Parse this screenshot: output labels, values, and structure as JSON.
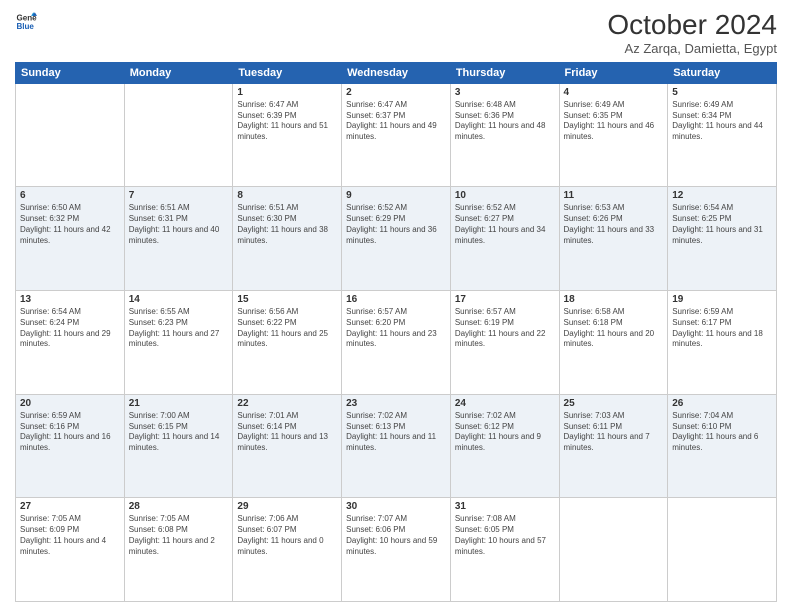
{
  "header": {
    "logo_line1": "General",
    "logo_line2": "Blue",
    "month": "October 2024",
    "location": "Az Zarqa, Damietta, Egypt"
  },
  "weekdays": [
    "Sunday",
    "Monday",
    "Tuesday",
    "Wednesday",
    "Thursday",
    "Friday",
    "Saturday"
  ],
  "weeks": [
    [
      {
        "day": "",
        "content": ""
      },
      {
        "day": "",
        "content": ""
      },
      {
        "day": "1",
        "content": "Sunrise: 6:47 AM\nSunset: 6:39 PM\nDaylight: 11 hours and 51 minutes."
      },
      {
        "day": "2",
        "content": "Sunrise: 6:47 AM\nSunset: 6:37 PM\nDaylight: 11 hours and 49 minutes."
      },
      {
        "day": "3",
        "content": "Sunrise: 6:48 AM\nSunset: 6:36 PM\nDaylight: 11 hours and 48 minutes."
      },
      {
        "day": "4",
        "content": "Sunrise: 6:49 AM\nSunset: 6:35 PM\nDaylight: 11 hours and 46 minutes."
      },
      {
        "day": "5",
        "content": "Sunrise: 6:49 AM\nSunset: 6:34 PM\nDaylight: 11 hours and 44 minutes."
      }
    ],
    [
      {
        "day": "6",
        "content": "Sunrise: 6:50 AM\nSunset: 6:32 PM\nDaylight: 11 hours and 42 minutes."
      },
      {
        "day": "7",
        "content": "Sunrise: 6:51 AM\nSunset: 6:31 PM\nDaylight: 11 hours and 40 minutes."
      },
      {
        "day": "8",
        "content": "Sunrise: 6:51 AM\nSunset: 6:30 PM\nDaylight: 11 hours and 38 minutes."
      },
      {
        "day": "9",
        "content": "Sunrise: 6:52 AM\nSunset: 6:29 PM\nDaylight: 11 hours and 36 minutes."
      },
      {
        "day": "10",
        "content": "Sunrise: 6:52 AM\nSunset: 6:27 PM\nDaylight: 11 hours and 34 minutes."
      },
      {
        "day": "11",
        "content": "Sunrise: 6:53 AM\nSunset: 6:26 PM\nDaylight: 11 hours and 33 minutes."
      },
      {
        "day": "12",
        "content": "Sunrise: 6:54 AM\nSunset: 6:25 PM\nDaylight: 11 hours and 31 minutes."
      }
    ],
    [
      {
        "day": "13",
        "content": "Sunrise: 6:54 AM\nSunset: 6:24 PM\nDaylight: 11 hours and 29 minutes."
      },
      {
        "day": "14",
        "content": "Sunrise: 6:55 AM\nSunset: 6:23 PM\nDaylight: 11 hours and 27 minutes."
      },
      {
        "day": "15",
        "content": "Sunrise: 6:56 AM\nSunset: 6:22 PM\nDaylight: 11 hours and 25 minutes."
      },
      {
        "day": "16",
        "content": "Sunrise: 6:57 AM\nSunset: 6:20 PM\nDaylight: 11 hours and 23 minutes."
      },
      {
        "day": "17",
        "content": "Sunrise: 6:57 AM\nSunset: 6:19 PM\nDaylight: 11 hours and 22 minutes."
      },
      {
        "day": "18",
        "content": "Sunrise: 6:58 AM\nSunset: 6:18 PM\nDaylight: 11 hours and 20 minutes."
      },
      {
        "day": "19",
        "content": "Sunrise: 6:59 AM\nSunset: 6:17 PM\nDaylight: 11 hours and 18 minutes."
      }
    ],
    [
      {
        "day": "20",
        "content": "Sunrise: 6:59 AM\nSunset: 6:16 PM\nDaylight: 11 hours and 16 minutes."
      },
      {
        "day": "21",
        "content": "Sunrise: 7:00 AM\nSunset: 6:15 PM\nDaylight: 11 hours and 14 minutes."
      },
      {
        "day": "22",
        "content": "Sunrise: 7:01 AM\nSunset: 6:14 PM\nDaylight: 11 hours and 13 minutes."
      },
      {
        "day": "23",
        "content": "Sunrise: 7:02 AM\nSunset: 6:13 PM\nDaylight: 11 hours and 11 minutes."
      },
      {
        "day": "24",
        "content": "Sunrise: 7:02 AM\nSunset: 6:12 PM\nDaylight: 11 hours and 9 minutes."
      },
      {
        "day": "25",
        "content": "Sunrise: 7:03 AM\nSunset: 6:11 PM\nDaylight: 11 hours and 7 minutes."
      },
      {
        "day": "26",
        "content": "Sunrise: 7:04 AM\nSunset: 6:10 PM\nDaylight: 11 hours and 6 minutes."
      }
    ],
    [
      {
        "day": "27",
        "content": "Sunrise: 7:05 AM\nSunset: 6:09 PM\nDaylight: 11 hours and 4 minutes."
      },
      {
        "day": "28",
        "content": "Sunrise: 7:05 AM\nSunset: 6:08 PM\nDaylight: 11 hours and 2 minutes."
      },
      {
        "day": "29",
        "content": "Sunrise: 7:06 AM\nSunset: 6:07 PM\nDaylight: 11 hours and 0 minutes."
      },
      {
        "day": "30",
        "content": "Sunrise: 7:07 AM\nSunset: 6:06 PM\nDaylight: 10 hours and 59 minutes."
      },
      {
        "day": "31",
        "content": "Sunrise: 7:08 AM\nSunset: 6:05 PM\nDaylight: 10 hours and 57 minutes."
      },
      {
        "day": "",
        "content": ""
      },
      {
        "day": "",
        "content": ""
      }
    ]
  ]
}
